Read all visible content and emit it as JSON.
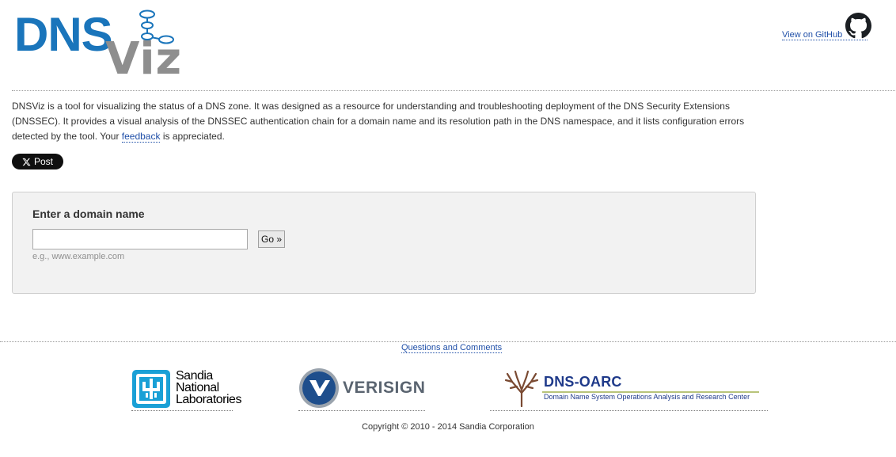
{
  "header": {
    "logo_dns": "DNS",
    "logo_viz": "Viz",
    "github_link": "View on GitHub"
  },
  "intro": {
    "part1": "DNSViz is a tool for visualizing the status of a DNS zone. It was designed as a resource for understanding and troubleshooting deployment of the DNS Security Extensions (DNSSEC). It provides a visual analysis of the DNSSEC authentication chain for a domain name and its resolution path in the DNS namespace, and it lists configuration errors detected by the tool. Your ",
    "feedback_link": "feedback",
    "part2": " is appreciated."
  },
  "social": {
    "post_label": "Post",
    "icon": "x-logo-icon"
  },
  "domain_form": {
    "title": "Enter a domain name",
    "input_value": "",
    "go_label": "Go »",
    "hint_prefix": "e.g.,",
    "hint_example": "www.example.com"
  },
  "footer": {
    "questions_link": "Questions and Comments",
    "sandia": {
      "line1": "Sandia",
      "line2": "National",
      "line3": "Laboratories"
    },
    "verisign": {
      "name": "VERISIGN",
      "mark": "."
    },
    "oarc": {
      "title": "DNS-OARC",
      "subtitle": "Domain Name System Operations Analysis and Research Center"
    },
    "copyright": "Copyright © 2010 - 2014 Sandia Corporation"
  },
  "colors": {
    "brand_blue": "#1a75bb",
    "brand_gray": "#8e8e8e",
    "link": "#1f4fa8",
    "box_bg": "#f2f2f2"
  }
}
